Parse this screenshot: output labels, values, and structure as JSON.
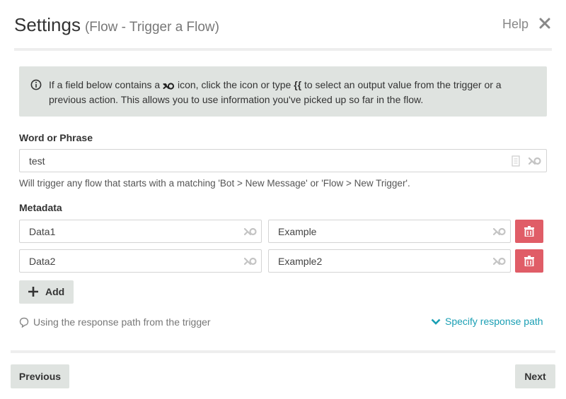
{
  "header": {
    "title": "Settings",
    "subtitle": "(Flow - Trigger a Flow)",
    "help_label": "Help",
    "close_icon": "close-icon"
  },
  "info": {
    "icon": "info-circle-icon",
    "text_before": "If a field below contains a",
    "text_middle": "icon, click the icon or type",
    "braces": "{{",
    "text_after": "to select an output value from the trigger or a previous action. This allows you to use information you've picked up so far in the flow."
  },
  "word_or_phrase": {
    "label": "Word or Phrase",
    "value": "test",
    "hint": "Will trigger any flow that starts with a matching 'Bot > New Message' or 'Flow > New Trigger'."
  },
  "metadata": {
    "label": "Metadata",
    "rows": [
      {
        "key": "Data1",
        "value": "Example"
      },
      {
        "key": "Data2",
        "value": "Example2"
      }
    ],
    "add_label": "Add"
  },
  "response": {
    "status_text": "Using the response path from the trigger",
    "specify_link": "Specify response path"
  },
  "footer": {
    "previous_label": "Previous",
    "next_label": "Next"
  },
  "colors": {
    "accent": "#1a9fb4",
    "delete": "#e05d67",
    "panel": "#dfe3e0"
  }
}
